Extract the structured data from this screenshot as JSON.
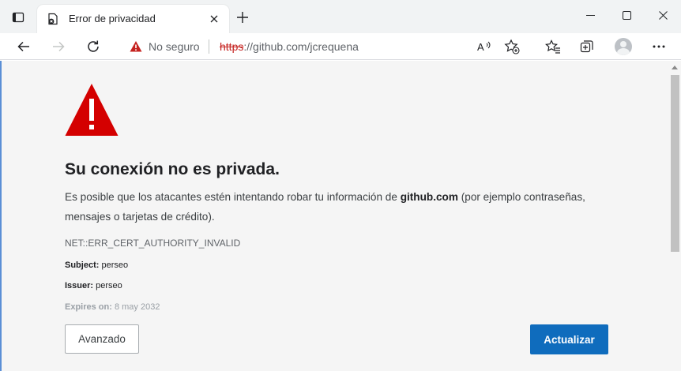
{
  "tab": {
    "title": "Error de privacidad"
  },
  "address_bar": {
    "security_label": "No seguro",
    "url_scheme": "https",
    "url_rest": "://github.com/jcrequena"
  },
  "error_page": {
    "headline": "Su conexión no es privada.",
    "explanation_before": "Es posible que los atacantes estén intentando robar tu información de ",
    "explanation_host": "github.com",
    "explanation_after": " (por ejemplo contraseñas, mensajes o tarjetas de crédito).",
    "error_code": "NET::ERR_CERT_AUTHORITY_INVALID",
    "certificate": {
      "subject_label": "Subject:",
      "subject_value": "perseo",
      "issuer_label": "Issuer:",
      "issuer_value": "perseo",
      "expires_label": "Expires on:",
      "expires_value": "8 may 2032"
    },
    "advanced_button": "Avanzado",
    "reload_button": "Actualizar"
  },
  "icons": {
    "tab_actions": "tab-actions-icon",
    "favicon": "privacy-error-favicon",
    "close": "close-icon",
    "new_tab": "plus-icon",
    "back": "back-arrow-icon",
    "forward": "forward-arrow-icon",
    "refresh": "refresh-icon",
    "warning": "warning-triangle-icon",
    "read_aloud": "read-aloud-icon",
    "add_favorite": "add-favorite-icon",
    "favorites": "favorites-icon",
    "collections": "collections-icon",
    "profile": "profile-avatar",
    "more": "more-icon"
  },
  "colors": {
    "danger_red": "#c5221f",
    "warning_triangle": "#d40000",
    "primary_button": "#0f6cbd"
  }
}
